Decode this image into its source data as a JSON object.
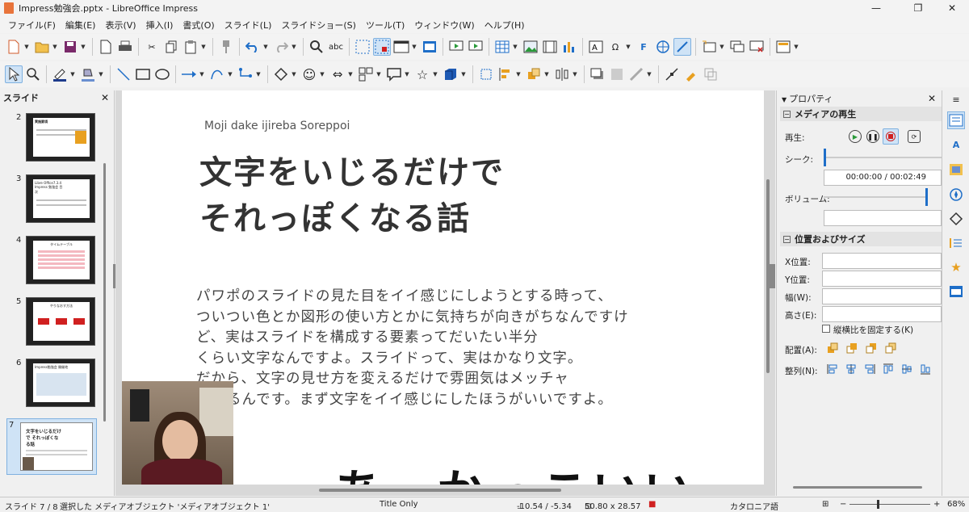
{
  "window": {
    "title": "Impress勉強会.pptx - LibreOffice Impress"
  },
  "menu": [
    "ファイル(F)",
    "編集(E)",
    "表示(V)",
    "挿入(I)",
    "書式(O)",
    "スライド(L)",
    "スライドショー(S)",
    "ツール(T)",
    "ウィンドウ(W)",
    "ヘルプ(H)"
  ],
  "slide_panel": {
    "title": "スライド",
    "slides": [
      {
        "num": "2",
        "label": "実施要項"
      },
      {
        "num": "3",
        "label": "Libre Office7.3.4 Impress 勉強会 目次"
      },
      {
        "num": "4",
        "label": "タイムテーブル"
      },
      {
        "num": "5",
        "label": "やりなおす方法"
      },
      {
        "num": "6",
        "label": "Impress勉強会 開催地"
      },
      {
        "num": "7",
        "label": "文字をいじるだけで それっぽくなる話"
      }
    ]
  },
  "slide": {
    "subtitle": "Moji dake ijireba Soreppoi",
    "title_line1": "文字をいじるだけで",
    "title_line2": "それっぽくなる話",
    "body": [
      "パワポのスライドの見た目をイイ感じにしようとする時って、",
      "ついつい色とか図形の使い方とかに気持ちが向きがちなんですけ",
      "ど、実はスライドを構成する要素ってだいたい半分",
      "くらい文字なんですよ。スライドって、実はかなり文字。",
      "だから、文字の見せ方を変えるだけで雰囲気はメッチャ",
      "るんです。まず文字をイイ感じにしたほうがいいですよ。"
    ],
    "big_text": "あ　かっこいい"
  },
  "sidebar": {
    "title": "プロパティ",
    "media": {
      "section": "メディアの再生",
      "play_label": "再生:",
      "seek_label": "シーク:",
      "time": "00:00:00 / 00:02:49",
      "volume_label": "ボリューム:"
    },
    "position": {
      "section": "位置およびサイズ",
      "x_label": "X位置:",
      "y_label": "Y位置:",
      "w_label": "幅(W):",
      "h_label": "高さ(E):",
      "keep_ratio": "縦横比を固定する(K)",
      "arrange_label": "配置(A):",
      "align_label": "整列(N):"
    }
  },
  "status": {
    "slide": "スライド 7 / 8",
    "selection": "選択した メディアオブジェクト 'メディアオブジェクト 1'",
    "layout": "Title Only",
    "position": "-10.54 / -5.34",
    "size": "50.80 x 28.57",
    "language": "カタロニア語",
    "zoom": "68%"
  },
  "colors": {
    "accent": "#1e6ec8",
    "selection": "#cfe3f6",
    "record": "#d02020"
  }
}
